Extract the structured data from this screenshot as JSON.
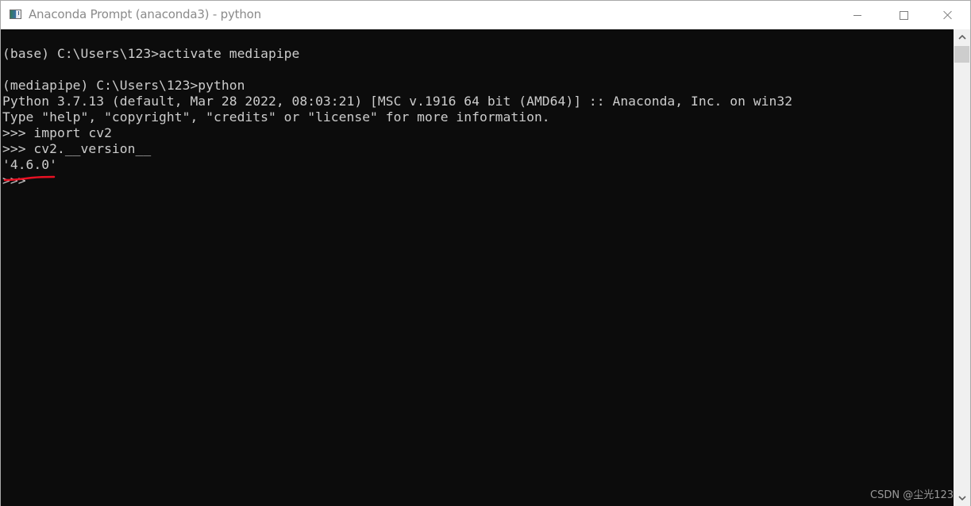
{
  "window": {
    "title": "Anaconda Prompt (anaconda3) - python",
    "icon": "console-app-icon",
    "controls": {
      "minimize": "minimize-icon",
      "maximize": "maximize-icon",
      "close": "close-icon"
    }
  },
  "console": {
    "lines": [
      "",
      "(base) C:\\Users\\123>activate mediapipe",
      "",
      "(mediapipe) C:\\Users\\123>python",
      "Python 3.7.13 (default, Mar 28 2022, 08:03:21) [MSC v.1916 64 bit (AMD64)] :: Anaconda, Inc. on win32",
      "Type \"help\", \"copyright\", \"credits\" or \"license\" for more information.",
      ">>> import cv2",
      ">>> cv2.__version__",
      "'4.6.0'",
      ">>>"
    ],
    "background": "#0c0c0c",
    "foreground": "#cccccc",
    "annotation_color": "#e81123"
  },
  "scrollbar": {
    "up": "chevron-up-icon",
    "down": "chevron-down-icon"
  },
  "watermark": "CSDN @尘光123"
}
